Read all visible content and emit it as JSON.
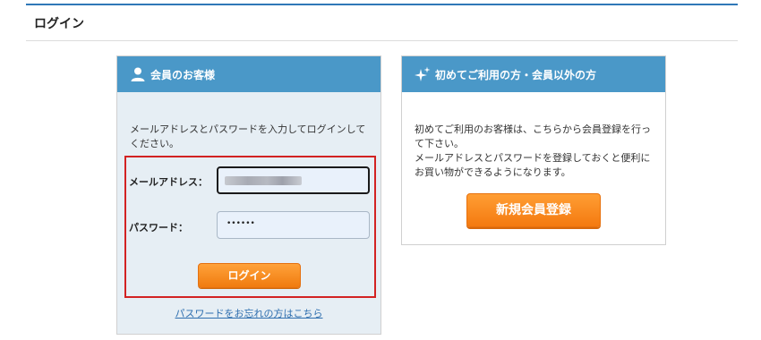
{
  "header": {
    "title": "ログイン"
  },
  "member": {
    "heading": "会員のお客様",
    "intro": "メールアドレスとパスワードを入力してログインしてください。",
    "email_label": "メールアドレス：",
    "password_label": "パスワード：",
    "password_value": "••••••",
    "login_button": "ログイン",
    "forgot_link": "パスワードをお忘れの方はこちら"
  },
  "guest": {
    "heading": "初めてご利用の方・会員以外の方",
    "line1": "初めてご利用のお客様は、こちらから会員登録を行って下さい。",
    "line2": "メールアドレスとパスワードを登録しておくと便利にお買い物ができるようになります。",
    "register_button": "新規会員登録"
  },
  "colors": {
    "header_accent": "#2f78b7",
    "panel_head": "#4a98c8",
    "button_orange": "#f07b0f",
    "highlight_frame": "#d22222",
    "link": "#2f6faf"
  },
  "icons": {
    "member": "user-icon",
    "guest": "sparkle-icon"
  }
}
